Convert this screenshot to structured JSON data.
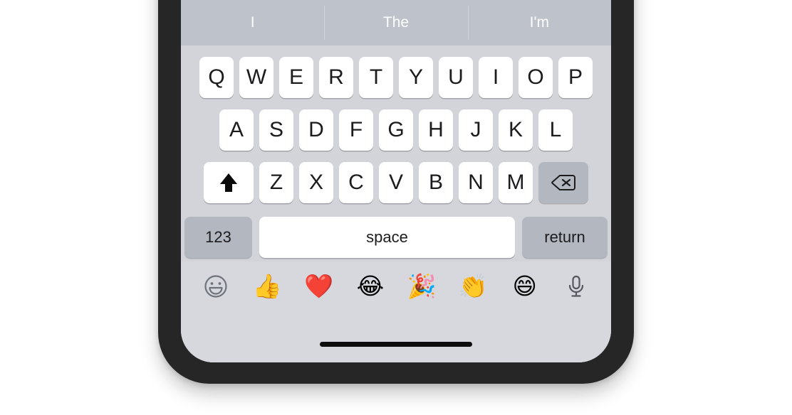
{
  "device": {
    "name": "iPhone",
    "frame_color": "#262626",
    "screen_bg": "#d2d4da",
    "home_indicator_color": "#0d0d0d"
  },
  "keyboard": {
    "background_color": "#d2d4da",
    "key_color": "#ffffff",
    "modifier_key_color": "#b3b7c0",
    "predictive_bar": {
      "background_color": "#bec2ca",
      "text_color": "#ffffff",
      "suggestions": [
        {
          "label": "I"
        },
        {
          "label": "The"
        },
        {
          "label": "I'm"
        }
      ]
    },
    "rows": [
      {
        "id": "row-1",
        "keys": [
          {
            "label": "Q"
          },
          {
            "label": "W"
          },
          {
            "label": "E"
          },
          {
            "label": "R"
          },
          {
            "label": "T"
          },
          {
            "label": "Y"
          },
          {
            "label": "U"
          },
          {
            "label": "I"
          },
          {
            "label": "O"
          },
          {
            "label": "P"
          }
        ]
      },
      {
        "id": "row-2",
        "keys": [
          {
            "label": "A"
          },
          {
            "label": "S"
          },
          {
            "label": "D"
          },
          {
            "label": "F"
          },
          {
            "label": "G"
          },
          {
            "label": "H"
          },
          {
            "label": "J"
          },
          {
            "label": "K"
          },
          {
            "label": "L"
          }
        ]
      },
      {
        "id": "row-3",
        "shift": {
          "icon": "shift-arrow-icon",
          "label": ""
        },
        "keys": [
          {
            "label": "Z"
          },
          {
            "label": "X"
          },
          {
            "label": "C"
          },
          {
            "label": "V"
          },
          {
            "label": "B"
          },
          {
            "label": "N"
          },
          {
            "label": "M"
          }
        ],
        "delete": {
          "icon": "backspace-icon",
          "label": ""
        }
      },
      {
        "id": "row-4",
        "numeric": {
          "label": "123"
        },
        "space": {
          "label": "space"
        },
        "return": {
          "label": "return"
        }
      }
    ],
    "emoji_row": {
      "background_color": "#d6d8de",
      "items": [
        {
          "icon": "emoji-keyboard-smiley-icon",
          "glyph": "",
          "name": "emoji-keyboard-toggle"
        },
        {
          "icon": "thumbs-up-emoji",
          "glyph": "👍",
          "name": "thumbs-up"
        },
        {
          "icon": "red-heart-emoji",
          "glyph": "❤️",
          "name": "red-heart"
        },
        {
          "icon": "face-with-tears-of-joy-emoji",
          "glyph": "😂",
          "name": "face-with-tears-of-joy"
        },
        {
          "icon": "party-popper-emoji",
          "glyph": "🎉",
          "name": "party-popper"
        },
        {
          "icon": "clapping-hands-emoji",
          "glyph": "👏",
          "name": "clapping-hands"
        },
        {
          "icon": "grinning-face-smiling-eyes-emoji",
          "glyph": "😄",
          "name": "grinning-face-with-smiling-eyes"
        },
        {
          "icon": "microphone-icon",
          "glyph": "",
          "name": "dictation-microphone"
        }
      ]
    }
  }
}
